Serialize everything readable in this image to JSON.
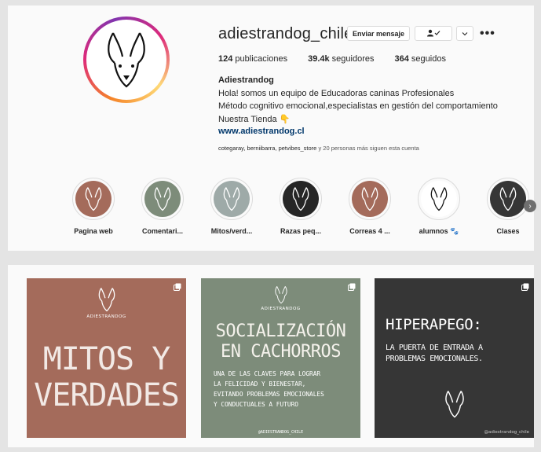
{
  "profile": {
    "username": "adiestrandog_chile",
    "buttons": {
      "message": "Enviar mensaje",
      "follow_icon": "person-check-icon",
      "dropdown_icon": "chevron-down-icon",
      "more": "•••"
    },
    "stats": {
      "posts_count": "124",
      "posts_label": "publicaciones",
      "followers_count": "39.4k",
      "followers_label": "seguidores",
      "following_count": "364",
      "following_label": "seguidos"
    },
    "full_name": "Adiestrandog",
    "bio": [
      "Hola! somos un equipo de Educadoras caninas Profesionales",
      "Método cognitivo emocional,especialistas en gestión del comportamiento",
      "Nuestra Tienda 👇"
    ],
    "website": "www.adiestrandog.cl",
    "followed_by_names": "cotegaray, berniibarra, petvibes_store",
    "followed_by_suffix": " y 20 personas más siguen esta cuenta"
  },
  "highlights": [
    {
      "label": "Pagina web",
      "bg": "#a46b5b"
    },
    {
      "label": "Comentari...",
      "bg": "#7d8c7a"
    },
    {
      "label": "Mitos/verd...",
      "bg": "#9eaaa8"
    },
    {
      "label": "Razas peq...",
      "bg": "#262626"
    },
    {
      "label": "Correas 4 ...",
      "bg": "#a46b5b"
    },
    {
      "label": "alumnos 🐾",
      "bg": "#ffffff"
    },
    {
      "label": "Clases",
      "bg": "#363636"
    }
  ],
  "posts": [
    {
      "brand": "ADIESTRANDOG",
      "title_1": "MITOS Y",
      "title_2": "VERDADES"
    },
    {
      "brand": "ADIESTRANDOG",
      "title_1": "SOCIALIZACIÓN",
      "title_2": "EN CACHORROS",
      "sub_1": "UNA DE LAS CLAVES PARA LOGRAR",
      "sub_2": "LA FELICIDAD Y BIENESTAR,",
      "sub_3": "EVITANDO PROBLEMAS EMOCIONALES",
      "sub_4": "Y CONDUCTUALES A FUTURO",
      "handle": "@ADIESTRANDOG_CHILE"
    },
    {
      "title": "HIPERAPEGO:",
      "sub_1": "LA PUERTA DE ENTRADA A",
      "sub_2": "PROBLEMAS EMOCIONALES.",
      "handle": "@adiestrandog_chile"
    }
  ],
  "colors": {
    "link": "#00376b",
    "card": "#fafafa",
    "page_bg": "#e4e4e4"
  }
}
